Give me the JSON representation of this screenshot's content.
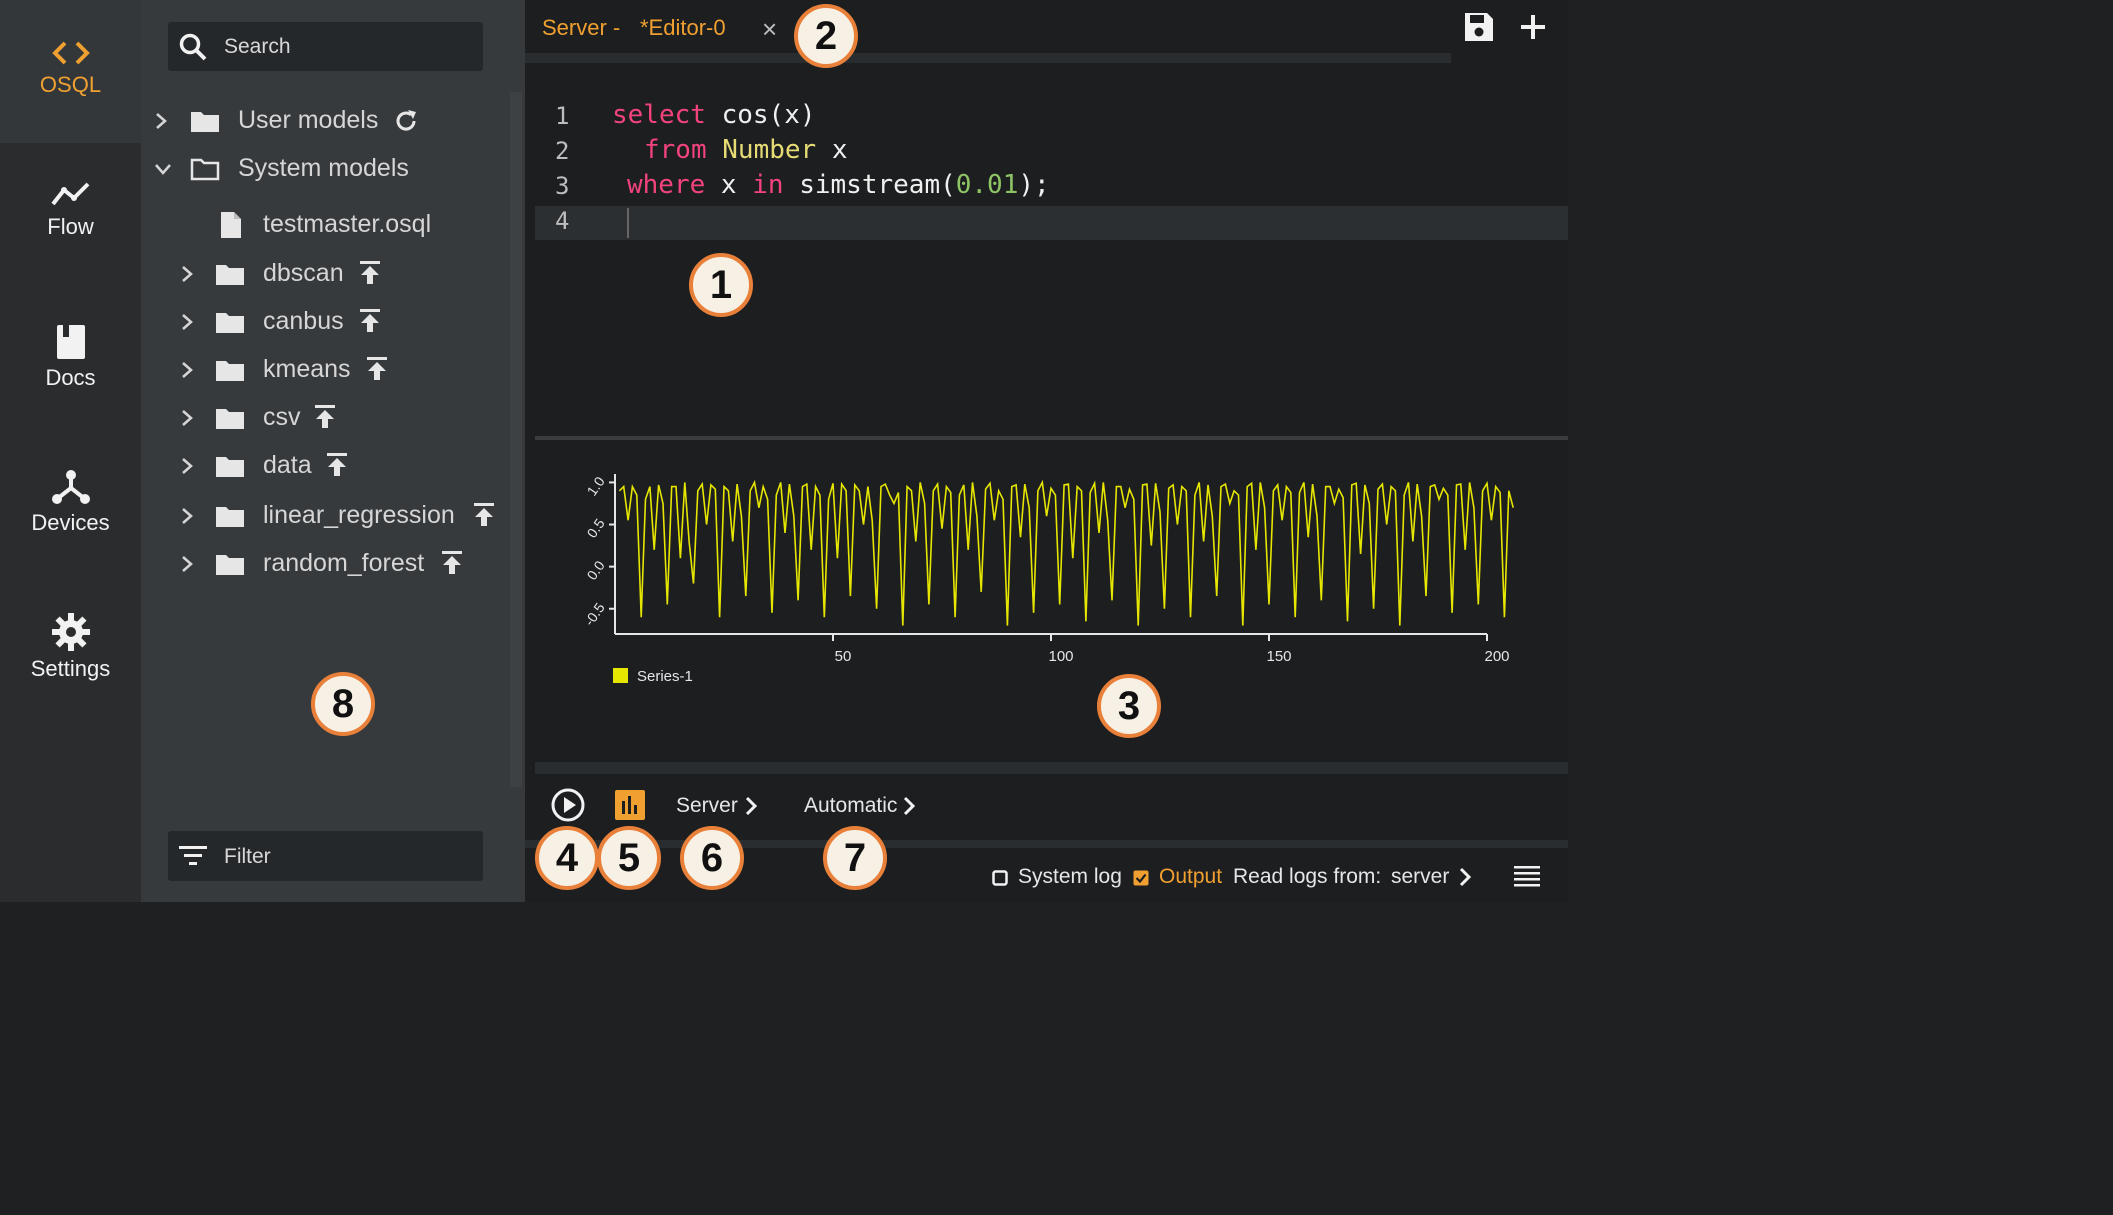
{
  "nav": {
    "items": [
      {
        "label": "OSQL",
        "icon": "code-brackets-icon",
        "active": true
      },
      {
        "label": "Flow",
        "icon": "flow-line-icon"
      },
      {
        "label": "Docs",
        "icon": "book-icon"
      },
      {
        "label": "Devices",
        "icon": "network-icon"
      },
      {
        "label": "Settings",
        "icon": "gear-icon"
      }
    ]
  },
  "tree": {
    "search_placeholder": "Search",
    "filter_label": "Filter",
    "items": [
      {
        "label": "User models",
        "type": "folder",
        "expanded": false
      },
      {
        "label": "System models",
        "type": "folder",
        "expanded": true
      },
      {
        "label": "testmaster.osql",
        "type": "file"
      },
      {
        "label": "dbscan",
        "type": "folder"
      },
      {
        "label": "canbus",
        "type": "folder"
      },
      {
        "label": "kmeans",
        "type": "folder"
      },
      {
        "label": "csv",
        "type": "folder"
      },
      {
        "label": "data",
        "type": "folder"
      },
      {
        "label": "linear_regression",
        "type": "folder"
      },
      {
        "label": "random_forest",
        "type": "folder"
      }
    ]
  },
  "editor": {
    "tab_server": "Server -",
    "tab_name": "*Editor-0",
    "tab_close": "×",
    "line_numbers": [
      "1",
      "2",
      "3",
      "4"
    ],
    "code": {
      "l1_kw": "select",
      "l1_rest": " cos(x)",
      "l2_kw": "from",
      "l2_type": "Number",
      "l2_rest": " x",
      "l3_kw1": "where",
      "l3_mid": " x ",
      "l3_kw2": "in",
      "l3_fn": " simstream(",
      "l3_num": "0.01",
      "l3_end": ");"
    }
  },
  "toolbar": {
    "server_label": "Server",
    "mode_label": "Automatic"
  },
  "status": {
    "system_log_label": "System log",
    "system_log_checked": false,
    "output_label": "Output",
    "output_checked": true,
    "read_logs_label": "Read logs from:",
    "read_logs_value": "server"
  },
  "callouts": [
    "1",
    "2",
    "3",
    "4",
    "5",
    "6",
    "7",
    "8"
  ],
  "colors": {
    "accent": "#f0a030",
    "series": "#e6e600",
    "keyword": "#f2437d",
    "type": "#e6db74",
    "number": "#8fc465"
  },
  "chart_data": {
    "type": "line",
    "xlim": [
      0,
      200
    ],
    "ylim": [
      -0.8,
      1.1
    ],
    "xticks": [
      "50",
      "100",
      "150",
      "200"
    ],
    "yticks": [
      "1.0",
      "0.5",
      "0.0",
      "-0.5"
    ],
    "legend_position": "bottom-left",
    "series": [
      {
        "name": "Series-1",
        "color": "#e6e600",
        "x_start": 1,
        "x_step": 1,
        "values": [
          0.9,
          0.95,
          0.55,
          0.95,
          0.85,
          -0.6,
          0.8,
          0.95,
          0.2,
          0.97,
          0.75,
          -0.45,
          0.95,
          0.95,
          0.1,
          1.0,
          0.3,
          -0.2,
          0.9,
          0.98,
          0.5,
          0.97,
          0.92,
          -0.6,
          0.95,
          0.9,
          0.3,
          0.98,
          0.6,
          -0.35,
          0.9,
          1.0,
          0.7,
          0.95,
          0.8,
          -0.55,
          0.85,
          1.0,
          0.4,
          0.98,
          0.6,
          -0.4,
          0.95,
          0.98,
          0.2,
          0.95,
          0.85,
          -0.6,
          0.8,
          0.99,
          0.1,
          0.98,
          0.9,
          -0.35,
          0.97,
          0.9,
          0.5,
          0.95,
          0.55,
          -0.5,
          0.95,
          0.98,
          0.85,
          0.75,
          0.88,
          -0.7,
          0.95,
          0.9,
          0.3,
          1.0,
          0.75,
          -0.45,
          0.9,
          0.98,
          0.45,
          0.95,
          0.88,
          -0.6,
          0.85,
          0.97,
          0.2,
          1.0,
          0.6,
          -0.3,
          0.92,
          0.99,
          0.55,
          0.9,
          0.8,
          -0.7,
          0.95,
          0.97,
          0.35,
          0.98,
          0.7,
          -0.55,
          0.9,
          1.0,
          0.6,
          0.93,
          0.85,
          -0.45,
          0.97,
          0.98,
          0.1,
          0.95,
          0.9,
          -0.65,
          0.88,
          0.99,
          0.4,
          1.0,
          0.55,
          -0.4,
          0.95,
          0.95,
          0.7,
          0.92,
          0.8,
          -0.7,
          0.97,
          0.98,
          0.25,
          0.99,
          0.65,
          -0.5,
          0.93,
          0.97,
          0.5,
          0.95,
          0.9,
          -0.6,
          0.85,
          1.0,
          0.3,
          0.97,
          0.6,
          -0.35,
          0.95,
          0.98,
          0.75,
          0.9,
          0.85,
          -0.7,
          0.95,
          0.99,
          0.2,
          1.0,
          0.7,
          -0.45,
          0.9,
          0.97,
          0.55,
          0.95,
          0.88,
          -0.6,
          0.88,
          1.0,
          0.35,
          0.98,
          0.6,
          -0.4,
          0.95,
          0.95,
          0.75,
          0.92,
          0.82,
          -0.65,
          0.97,
          0.99,
          0.15,
          0.97,
          0.75,
          -0.5,
          0.92,
          0.98,
          0.5,
          0.95,
          0.9,
          -0.7,
          0.85,
          1.0,
          0.3,
          0.98,
          0.6,
          -0.35,
          0.95,
          0.97,
          0.8,
          0.93,
          0.85,
          -0.55,
          0.97,
          0.98,
          0.2,
          1.0,
          0.7,
          -0.45,
          0.9,
          0.99,
          0.55,
          0.95,
          0.88,
          -0.6,
          0.9,
          0.7
        ]
      }
    ]
  }
}
